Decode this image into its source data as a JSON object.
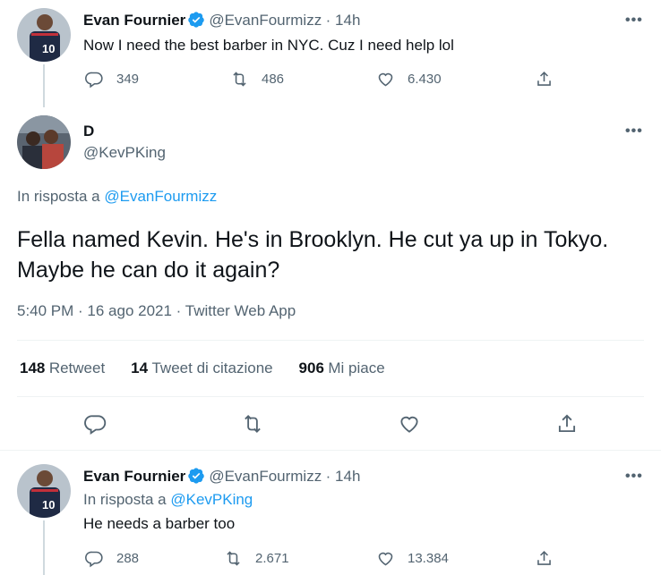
{
  "tweet1": {
    "name": "Evan Fournier",
    "handle": "@EvanFourmizz",
    "time": "· 14h",
    "text": "Now I need the best barber in NYC. Cuz I need help lol",
    "replies": "349",
    "retweets": "486",
    "likes": "6.430"
  },
  "main": {
    "name": "D",
    "handle": "@KevPKing",
    "reply_prefix": "In risposta a",
    "reply_to": "@EvanFourmizz",
    "text": "Fella named Kevin. He's in Brooklyn.  He cut ya up in Tokyo.  Maybe he can do it again?",
    "timestamp": "5:40 PM · 16 ago 2021 · Twitter Web App",
    "stats": {
      "retweets_num": "148",
      "retweets_lbl": "Retweet",
      "quotes_num": "14",
      "quotes_lbl": "Tweet di citazione",
      "likes_num": "906",
      "likes_lbl": "Mi piace"
    }
  },
  "tweet3": {
    "name": "Evan Fournier",
    "handle": "@EvanFourmizz",
    "time": "· 14h",
    "reply_prefix": "In risposta a",
    "reply_to": "@KevPKing",
    "text": "He needs a barber too",
    "replies": "288",
    "retweets": "2.671",
    "likes": "13.384"
  },
  "more_label": "•••",
  "colors": {
    "accent": "#1d9bf0",
    "muted": "#536471",
    "divider": "#eff3f4"
  }
}
